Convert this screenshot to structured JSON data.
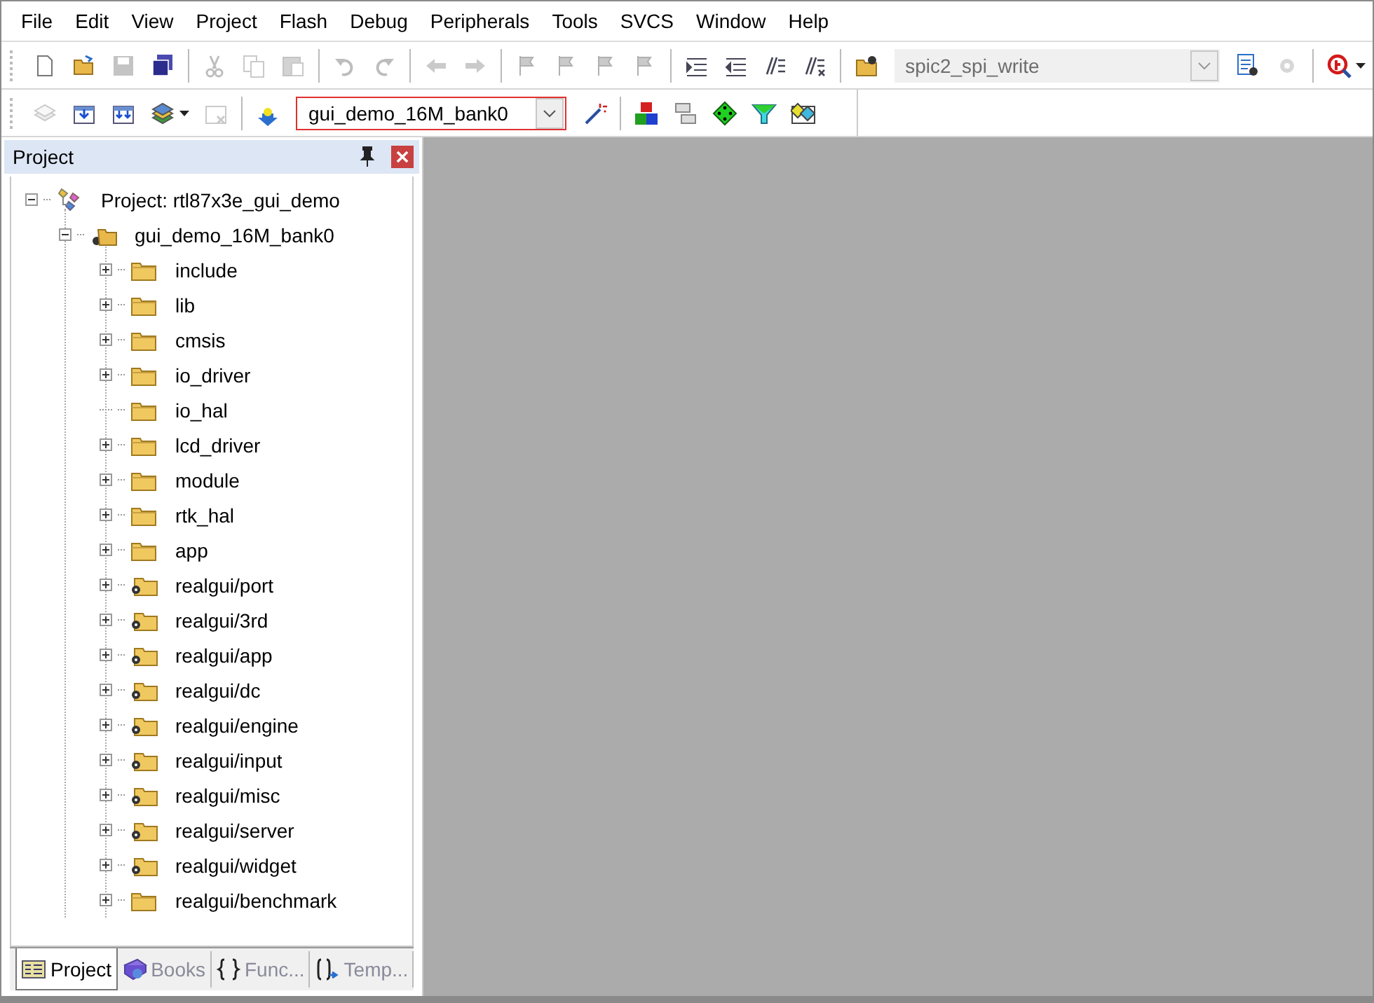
{
  "menu": [
    {
      "label": "File"
    },
    {
      "label": "Edit"
    },
    {
      "label": "View"
    },
    {
      "label": "Project"
    },
    {
      "label": "Flash"
    },
    {
      "label": "Debug"
    },
    {
      "label": "Peripherals"
    },
    {
      "label": "Tools"
    },
    {
      "label": "SVCS"
    },
    {
      "label": "Window"
    },
    {
      "label": "Help"
    }
  ],
  "toolbar_1": {
    "buttons": [
      {
        "disabled": false
      },
      {
        "disabled": false
      },
      {
        "disabled": true
      },
      {
        "disabled": false
      },
      {
        "disabled": true
      },
      {
        "disabled": true
      },
      {
        "disabled": true
      },
      {
        "disabled": true
      },
      {
        "disabled": true
      },
      {
        "disabled": true
      },
      {
        "disabled": true
      },
      {
        "disabled": true
      },
      {
        "disabled": true
      },
      {
        "disabled": true
      },
      {
        "disabled": true
      },
      {
        "disabled": false
      },
      {
        "disabled": false
      },
      {
        "disabled": false
      },
      {
        "disabled": false
      },
      {
        "disabled": false
      },
      {
        "disabled": false
      },
      {
        "disabled": true
      },
      {
        "disabled": false
      }
    ],
    "function_combo": {
      "value": "spic2_spi_write",
      "disabled": true
    }
  },
  "toolbar_2": {
    "buttons": [
      {
        "disabled": true
      },
      {
        "disabled": false
      },
      {
        "disabled": false
      },
      {
        "disabled": false
      },
      {
        "disabled": true
      },
      {
        "disabled": false
      },
      {
        "disabled": false
      },
      {
        "disabled": false
      },
      {
        "disabled": false
      },
      {
        "disabled": false
      },
      {
        "disabled": false
      },
      {
        "disabled": false
      }
    ],
    "target_combo": {
      "value": "gui_demo_16M_bank0",
      "focused": true
    }
  },
  "project_panel": {
    "title": "Project",
    "tree": [
      {
        "label": "Project: rtl87x3e_gui_demo",
        "kind": "project",
        "expanded": true,
        "children": [
          {
            "label": "gui_demo_16M_bank0",
            "kind": "target",
            "expanded": true,
            "children": [
              {
                "label": "include",
                "kind": "folder",
                "expanded": false
              },
              {
                "label": "lib",
                "kind": "folder",
                "expanded": false
              },
              {
                "label": "cmsis",
                "kind": "folder",
                "expanded": false
              },
              {
                "label": "io_driver",
                "kind": "folder",
                "expanded": false
              },
              {
                "label": "io_hal",
                "kind": "folder"
              },
              {
                "label": "lcd_driver",
                "kind": "folder",
                "expanded": false
              },
              {
                "label": "module",
                "kind": "folder",
                "expanded": false
              },
              {
                "label": "rtk_hal",
                "kind": "folder",
                "expanded": false
              },
              {
                "label": "app",
                "kind": "folder",
                "expanded": false
              },
              {
                "label": "realgui/port",
                "kind": "option_folder",
                "expanded": false
              },
              {
                "label": "realgui/3rd",
                "kind": "option_folder",
                "expanded": false
              },
              {
                "label": "realgui/app",
                "kind": "option_folder",
                "expanded": false
              },
              {
                "label": "realgui/dc",
                "kind": "option_folder",
                "expanded": false
              },
              {
                "label": "realgui/engine",
                "kind": "option_folder",
                "expanded": false
              },
              {
                "label": "realgui/input",
                "kind": "option_folder",
                "expanded": false
              },
              {
                "label": "realgui/misc",
                "kind": "option_folder",
                "expanded": false
              },
              {
                "label": "realgui/server",
                "kind": "option_folder",
                "expanded": false
              },
              {
                "label": "realgui/widget",
                "kind": "option_folder",
                "expanded": false
              },
              {
                "label": "realgui/benchmark",
                "kind": "folder",
                "expanded": false
              }
            ]
          }
        ]
      }
    ],
    "tabs": [
      {
        "label": "Project",
        "selected": true
      },
      {
        "label": "Books",
        "selected": false
      },
      {
        "label": "Func...",
        "selected": false
      },
      {
        "label": "Temp...",
        "selected": false
      }
    ]
  }
}
